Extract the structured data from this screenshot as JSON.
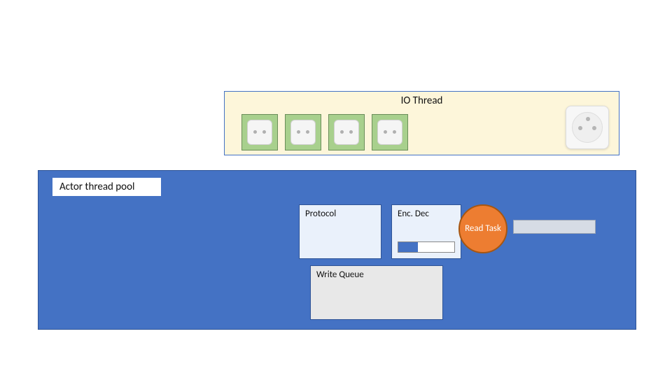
{
  "io_thread": {
    "label": "IO Thread"
  },
  "actor_pool": {
    "label": "Actor thread pool",
    "protocol_label": "Protocol",
    "encdec_label": "Enc. Dec",
    "write_queue_label": "Write Queue",
    "read_task_label": "Read Task"
  }
}
